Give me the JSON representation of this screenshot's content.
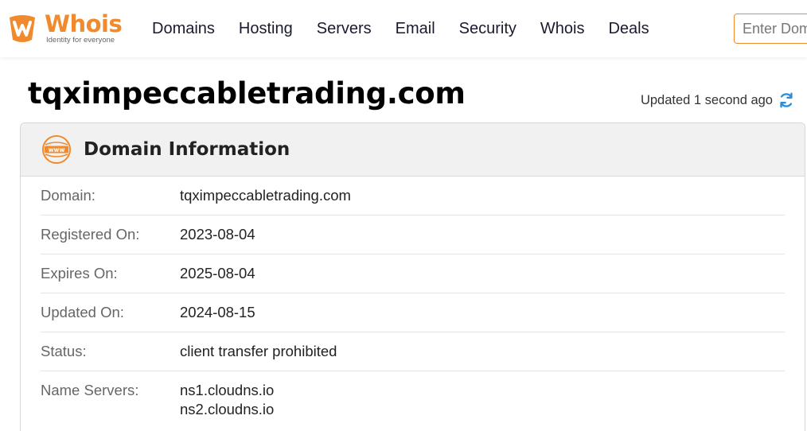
{
  "brand": {
    "name": "Whois",
    "tagline": "Identity for everyone",
    "color": "#f08a2c"
  },
  "nav": {
    "items": [
      {
        "label": "Domains"
      },
      {
        "label": "Hosting"
      },
      {
        "label": "Servers"
      },
      {
        "label": "Email"
      },
      {
        "label": "Security"
      },
      {
        "label": "Whois"
      },
      {
        "label": "Deals"
      }
    ]
  },
  "search": {
    "placeholder": "Enter Domain or IP",
    "value": ""
  },
  "page": {
    "title": "tqximpeccabletrading.com",
    "updated": "Updated 1 second ago"
  },
  "card": {
    "title": "Domain Information",
    "icon": "www-icon",
    "rows": [
      {
        "label": "Domain:",
        "value": "tqximpeccabletrading.com"
      },
      {
        "label": "Registered On:",
        "value": "2023-08-04"
      },
      {
        "label": "Expires On:",
        "value": "2025-08-04"
      },
      {
        "label": "Updated On:",
        "value": "2024-08-15"
      },
      {
        "label": "Status:",
        "value": "client transfer prohibited"
      },
      {
        "label": "Name Servers:",
        "values": [
          "ns1.cloudns.io",
          "ns2.cloudns.io"
        ]
      }
    ]
  },
  "colors": {
    "accent": "#f08a2c",
    "refresh": "#2a8fd8",
    "headerBg": "#f1f1f1"
  }
}
